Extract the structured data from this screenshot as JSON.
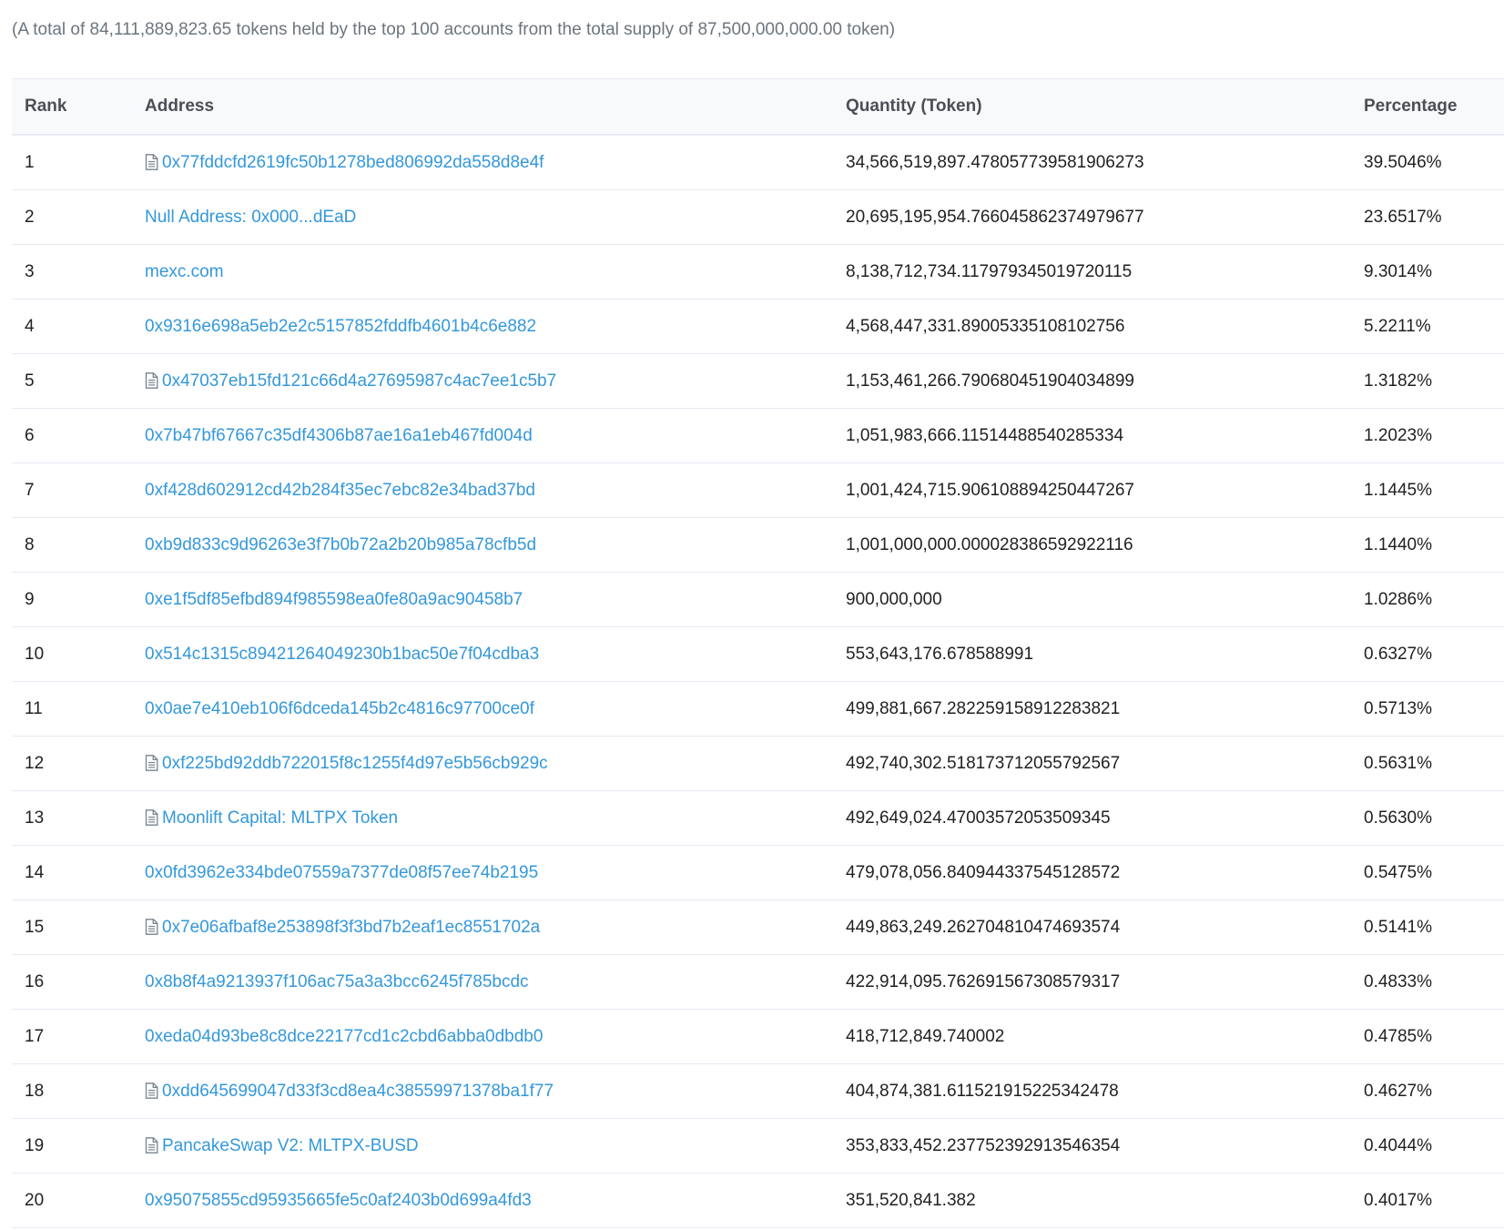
{
  "summary": "(A total of 84,111,889,823.65 tokens held by the top 100 accounts from the total supply of 87,500,000,000.00 token)",
  "columns": {
    "rank": "Rank",
    "address": "Address",
    "quantity": "Quantity (Token)",
    "percentage": "Percentage"
  },
  "colors": {
    "link": "#3498db",
    "header_bg": "#f8f9fa",
    "border": "#e7eaf3"
  },
  "rows": [
    {
      "rank": "1",
      "address": "0x77fddcfd2619fc50b1278bed806992da558d8e4f",
      "contract": true,
      "quantity": "34,566,519,897.478057739581906273",
      "percentage": "39.5046%"
    },
    {
      "rank": "2",
      "address": "Null Address: 0x000...dEaD",
      "contract": false,
      "quantity": "20,695,195,954.766045862374979677",
      "percentage": "23.6517%"
    },
    {
      "rank": "3",
      "address": "mexc.com",
      "contract": false,
      "quantity": "8,138,712,734.117979345019720115",
      "percentage": "9.3014%"
    },
    {
      "rank": "4",
      "address": "0x9316e698a5eb2e2c5157852fddfb4601b4c6e882",
      "contract": false,
      "quantity": "4,568,447,331.89005335108102756",
      "percentage": "5.2211%"
    },
    {
      "rank": "5",
      "address": "0x47037eb15fd121c66d4a27695987c4ac7ee1c5b7",
      "contract": true,
      "quantity": "1,153,461,266.790680451904034899",
      "percentage": "1.3182%"
    },
    {
      "rank": "6",
      "address": "0x7b47bf67667c35df4306b87ae16a1eb467fd004d",
      "contract": false,
      "quantity": "1,051,983,666.11514488540285334",
      "percentage": "1.2023%"
    },
    {
      "rank": "7",
      "address": "0xf428d602912cd42b284f35ec7ebc82e34bad37bd",
      "contract": false,
      "quantity": "1,001,424,715.906108894250447267",
      "percentage": "1.1445%"
    },
    {
      "rank": "8",
      "address": "0xb9d833c9d96263e3f7b0b72a2b20b985a78cfb5d",
      "contract": false,
      "quantity": "1,001,000,000.000028386592922116",
      "percentage": "1.1440%"
    },
    {
      "rank": "9",
      "address": "0xe1f5df85efbd894f985598ea0fe80a9ac90458b7",
      "contract": false,
      "quantity": "900,000,000",
      "percentage": "1.0286%"
    },
    {
      "rank": "10",
      "address": "0x514c1315c89421264049230b1bac50e7f04cdba3",
      "contract": false,
      "quantity": "553,643,176.678588991",
      "percentage": "0.6327%"
    },
    {
      "rank": "11",
      "address": "0x0ae7e410eb106f6dceda145b2c4816c97700ce0f",
      "contract": false,
      "quantity": "499,881,667.282259158912283821",
      "percentage": "0.5713%"
    },
    {
      "rank": "12",
      "address": "0xf225bd92ddb722015f8c1255f4d97e5b56cb929c",
      "contract": true,
      "quantity": "492,740,302.518173712055792567",
      "percentage": "0.5631%"
    },
    {
      "rank": "13",
      "address": "Moonlift Capital: MLTPX Token",
      "contract": true,
      "quantity": "492,649,024.47003572053509345",
      "percentage": "0.5630%"
    },
    {
      "rank": "14",
      "address": "0x0fd3962e334bde07559a7377de08f57ee74b2195",
      "contract": false,
      "quantity": "479,078,056.840944337545128572",
      "percentage": "0.5475%"
    },
    {
      "rank": "15",
      "address": "0x7e06afbaf8e253898f3f3bd7b2eaf1ec8551702a",
      "contract": true,
      "quantity": "449,863,249.262704810474693574",
      "percentage": "0.5141%"
    },
    {
      "rank": "16",
      "address": "0x8b8f4a9213937f106ac75a3a3bcc6245f785bcdc",
      "contract": false,
      "quantity": "422,914,095.762691567308579317",
      "percentage": "0.4833%"
    },
    {
      "rank": "17",
      "address": "0xeda04d93be8c8dce22177cd1c2cbd6abba0dbdb0",
      "contract": false,
      "quantity": "418,712,849.740002",
      "percentage": "0.4785%"
    },
    {
      "rank": "18",
      "address": "0xdd645699047d33f3cd8ea4c38559971378ba1f77",
      "contract": true,
      "quantity": "404,874,381.611521915225342478",
      "percentage": "0.4627%"
    },
    {
      "rank": "19",
      "address": "PancakeSwap V2: MLTPX-BUSD",
      "contract": true,
      "quantity": "353,833,452.237752392913546354",
      "percentage": "0.4044%"
    },
    {
      "rank": "20",
      "address": "0x95075855cd95935665fe5c0af2403b0d699a4fd3",
      "contract": false,
      "quantity": "351,520,841.382",
      "percentage": "0.4017%"
    }
  ]
}
